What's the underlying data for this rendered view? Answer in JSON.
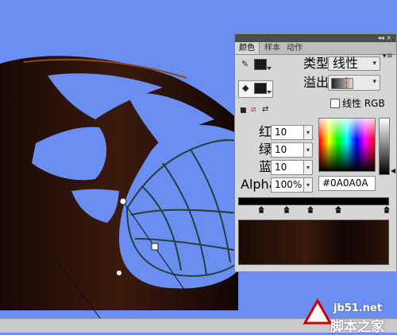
{
  "panel": {
    "tabs": [
      "颜色",
      "样本",
      "动作"
    ],
    "type_label": "类型:",
    "type_value": "线性",
    "overflow_label": "溢出:",
    "linear_rgb_label": "线性 RGB",
    "linear_rgb_checked": false,
    "red_label": "红:",
    "red_value": "10",
    "green_label": "绿:",
    "green_value": "10",
    "blue_label": "蓝:",
    "blue_value": "10",
    "alpha_label": "Alpha:",
    "alpha_value": "100%",
    "hex_value": "#0A0A0A"
  },
  "colors": {
    "canvas_background": "#6b8ef2",
    "wing_dark": "#1e0d08",
    "wing_vein": "#23403a",
    "fill_color": "#0a0a0a"
  },
  "watermark": {
    "site": "jb51.net",
    "name": "脚本之家"
  }
}
